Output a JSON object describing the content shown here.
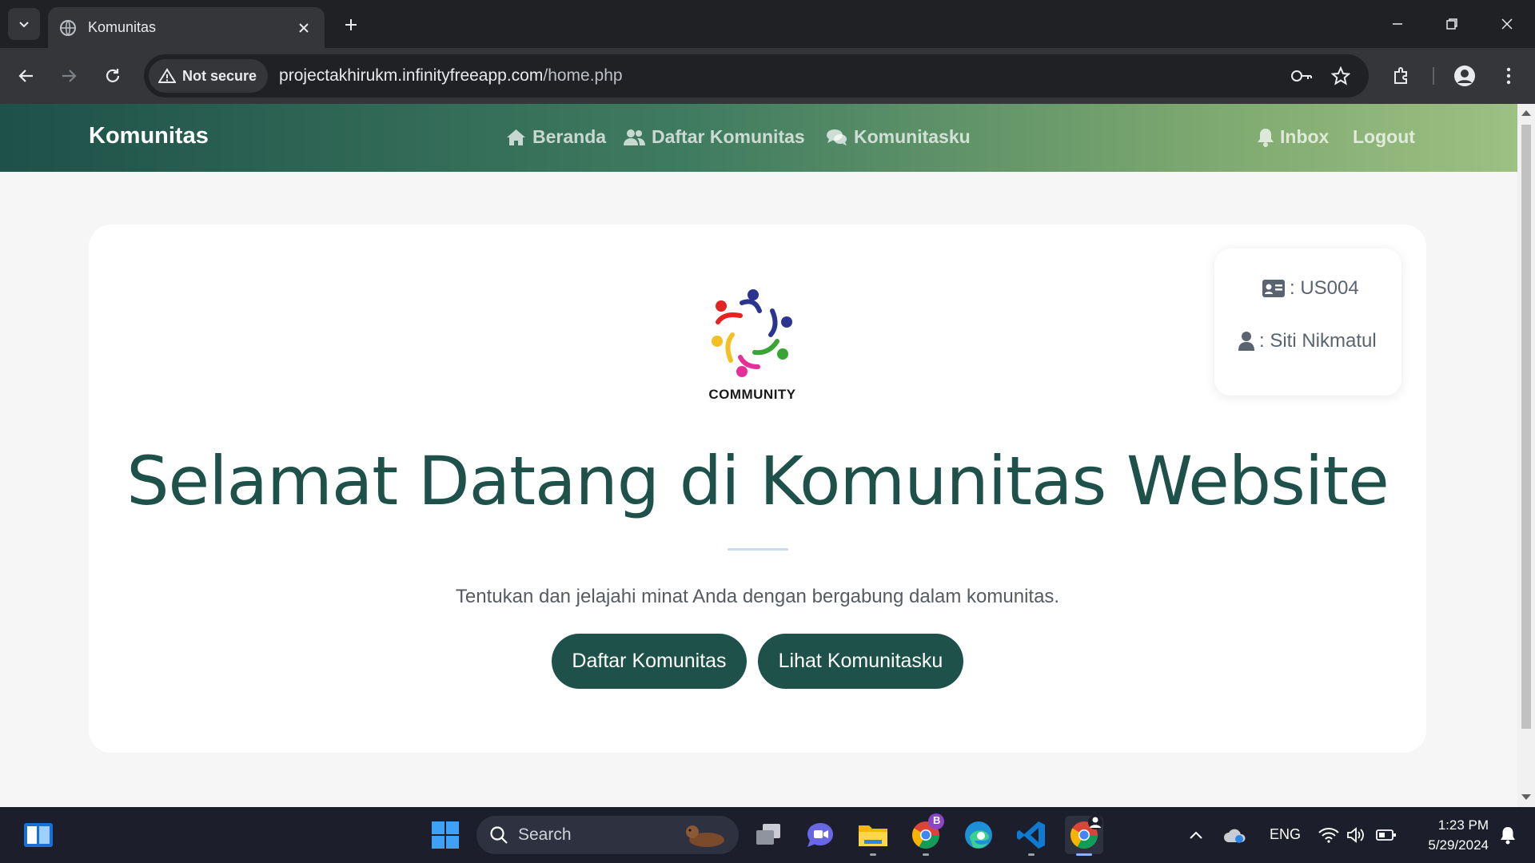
{
  "browser": {
    "tab_title": "Komunitas",
    "security_label": "Not secure",
    "url_host": "projectakhirukm.infinityfreeapp.com",
    "url_path": "/home.php"
  },
  "navbar": {
    "brand": "Komunitas",
    "links": [
      {
        "label": "Beranda",
        "icon": "home-icon"
      },
      {
        "label": "Daftar Komunitas",
        "icon": "users-icon"
      },
      {
        "label": "Komunitasku",
        "icon": "comments-icon"
      }
    ],
    "right_links": [
      {
        "label": "Inbox",
        "icon": "bell-icon"
      },
      {
        "label": "Logout"
      }
    ]
  },
  "user_card": {
    "id_text": ": US004",
    "name_text": ": Siti Nikmatul"
  },
  "hero": {
    "logo_text": "COMMUNITY",
    "headline": "Selamat Datang di Komunitas Website",
    "subtext": "Tentukan dan jelajahi minat Anda dengan bergabung dalam komunitas.",
    "buttons": [
      "Daftar Komunitas",
      "Lihat Komunitasku"
    ]
  },
  "taskbar": {
    "search_placeholder": "Search",
    "chrome_badge": "B",
    "language": "ENG",
    "time": "1:23 PM",
    "date": "5/29/2024"
  },
  "colors": {
    "primary": "#1e5149",
    "navbar_gradient_start": "#1e5149",
    "navbar_gradient_end": "#9dc083",
    "page_background": "#f6f6f6"
  }
}
